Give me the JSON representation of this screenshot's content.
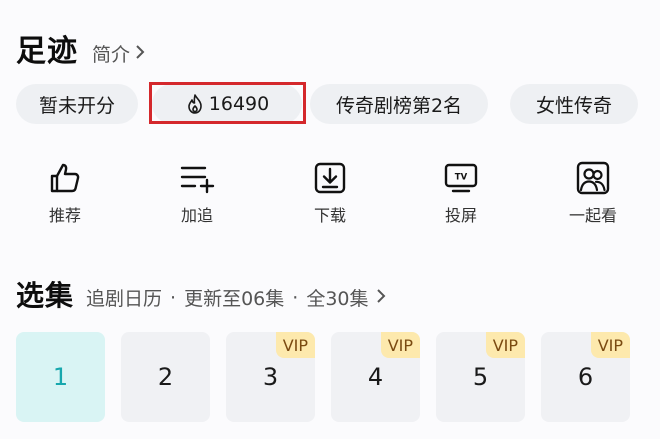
{
  "header": {
    "title": "足迹",
    "intro_label": "简介"
  },
  "tags": [
    {
      "label": "暂未开分"
    },
    {
      "label": "16490",
      "icon": "flame-icon"
    },
    {
      "label": "传奇剧榜第2名"
    },
    {
      "label": "女性传奇"
    }
  ],
  "actions": [
    {
      "label": "推荐",
      "icon": "thumbs-up-icon"
    },
    {
      "label": "加追",
      "icon": "add-list-icon"
    },
    {
      "label": "下载",
      "icon": "download-icon"
    },
    {
      "label": "投屏",
      "icon": "tv-cast-icon"
    },
    {
      "label": "一起看",
      "icon": "watch-together-icon"
    }
  ],
  "episodes": {
    "title": "选集",
    "calendar_label": "追剧日历",
    "update_label": "更新至06集",
    "total_label": "全30集",
    "separator": "·",
    "items": [
      {
        "number": "1",
        "vip": ""
      },
      {
        "number": "2",
        "vip": ""
      },
      {
        "number": "3",
        "vip": "VIP"
      },
      {
        "number": "4",
        "vip": "VIP"
      },
      {
        "number": "5",
        "vip": "VIP"
      },
      {
        "number": "6",
        "vip": "VIP"
      }
    ]
  },
  "colors": {
    "active_episode_bg": "#d9f4f4",
    "active_episode_text": "#17a7ad",
    "vip_badge_bg": "#fde9ad",
    "highlight_border": "#d4282c"
  }
}
